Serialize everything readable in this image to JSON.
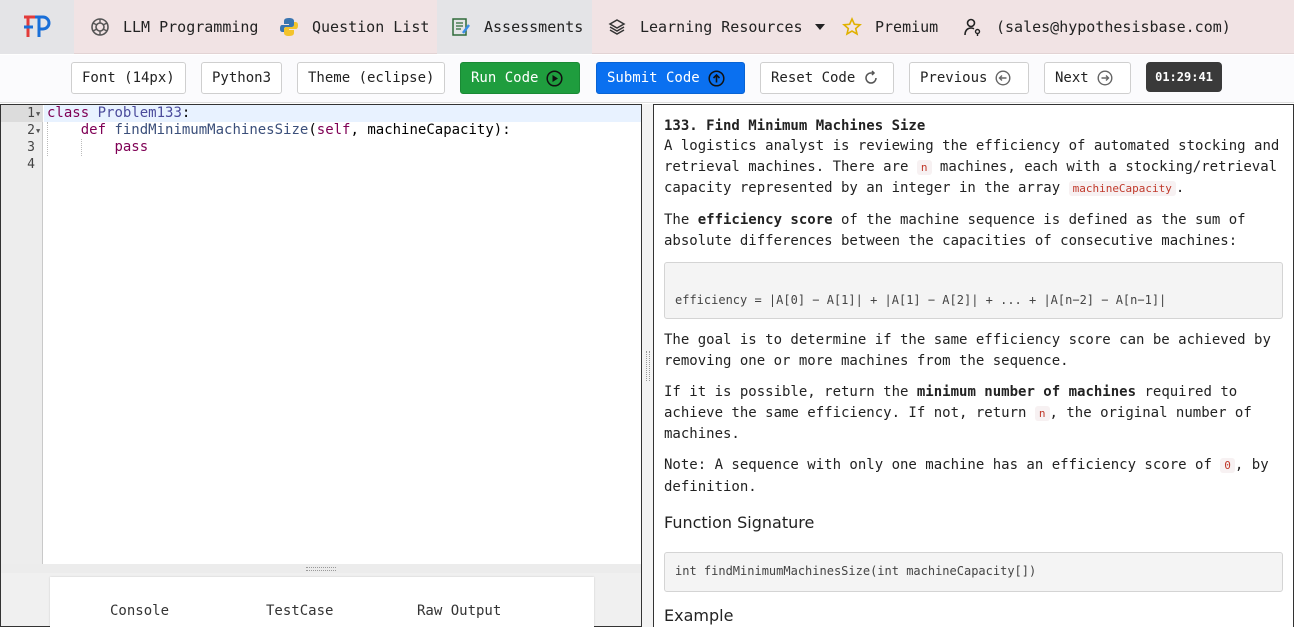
{
  "nav": {
    "items": [
      {
        "label": "LLM Programming",
        "icon": "openai-icon"
      },
      {
        "label": "Question List",
        "icon": "python-icon"
      },
      {
        "label": "Assessments",
        "icon": "assessment-icon"
      },
      {
        "label": "Learning Resources",
        "icon": "layers-icon"
      },
      {
        "label": "Premium",
        "icon": "star-icon"
      },
      {
        "label": "(sales@hypothesisbase.com)",
        "icon": "user-key-icon"
      }
    ],
    "active": "Assessments"
  },
  "toolbar": {
    "font": "Font (14px)",
    "language": "Python3",
    "theme": "Theme (eclipse)",
    "run": "Run Code",
    "submit": "Submit Code",
    "reset": "Reset Code",
    "previous": "Previous",
    "next": "Next",
    "timer": "01:29:41"
  },
  "editor": {
    "line_numbers": [
      "1",
      "2",
      "3",
      "4"
    ],
    "lines": {
      "l1_kw": "class",
      "l1_name": "Problem133",
      "l1_colon": ":",
      "l2_kw": "def",
      "l2_fn": "findMinimumMachinesSize",
      "l2_open": "(",
      "l2_self": "self",
      "l2_rest": ", machineCapacity):",
      "l3_kw": "pass"
    }
  },
  "console": {
    "tabs": [
      "Console",
      "TestCase",
      "Raw Output"
    ]
  },
  "problem": {
    "title": "133. Find Minimum Machines Size",
    "p1_a": "A logistics analyst is reviewing the efficiency of automated stocking and retrieval machines. There are ",
    "p1_n": "n",
    "p1_b": " machines, each with a stocking/retrieval capacity represented by an integer in the array ",
    "p1_arr": "machineCapacity",
    "p1_c": ".",
    "p2_a": "The ",
    "p2_bold": "efficiency score",
    "p2_b": " of the machine sequence is defined as the sum of absolute differences between the capacities of consecutive machines:",
    "formula": "efficiency = |A[0] − A[1]| + |A[1] − A[2]| + ... + |A[n−2] − A[n−1]|",
    "p3": "The goal is to determine if the same efficiency score can be achieved by removing one or more machines from the sequence.",
    "p4_a": "If it is possible, return the ",
    "p4_bold": "minimum number of machines",
    "p4_b": " required to achieve the same efficiency. If not, return ",
    "p4_n": "n",
    "p4_c": ", the original number of machines.",
    "p5_a": "Note: A sequence with only one machine has an efficiency score of ",
    "p5_zero": "0",
    "p5_b": ", by definition.",
    "sig_heading": "Function Signature",
    "signature": "int findMinimumMachinesSize(int machineCapacity[])",
    "example_heading": "Example"
  },
  "colors": {
    "nav_bg": "#f1e3e4",
    "run_green": "#1f9d3e",
    "submit_blue": "#0a70f0",
    "timer_bg": "#3a3a3a"
  }
}
